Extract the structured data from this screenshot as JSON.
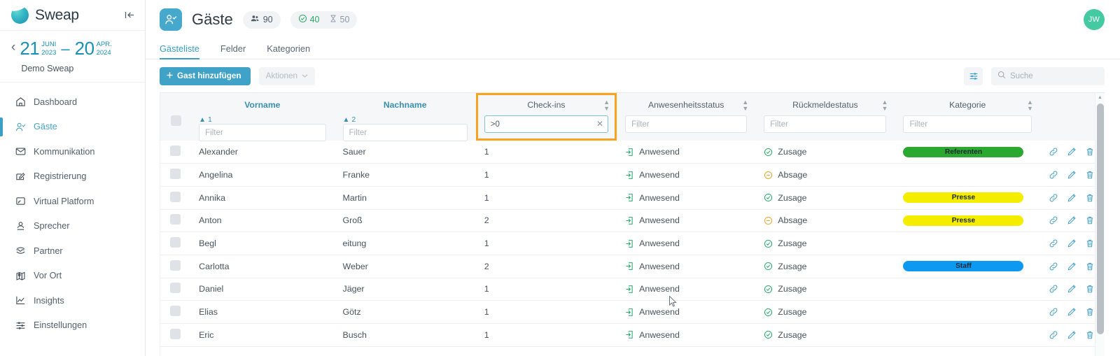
{
  "sidebar": {
    "brand": {
      "name": "Sweap",
      "logo_icon": "sweap-logo",
      "collapse_icon": "collapse-panel-icon"
    },
    "event": {
      "back_icon": "chevron-left-icon",
      "start_day": "21",
      "start_month": "JUNI",
      "start_year": "2023",
      "dash": "–",
      "end_day": "20",
      "end_month": "APR.",
      "end_year": "2024",
      "event_name": "Demo Sweap"
    },
    "items": [
      {
        "label": "Dashboard",
        "icon": "home-icon",
        "active": false
      },
      {
        "label": "Gäste",
        "icon": "user-check-icon",
        "active": true
      },
      {
        "label": "Kommunikation",
        "icon": "envelope-icon",
        "active": false
      },
      {
        "label": "Registrierung",
        "icon": "form-edit-icon",
        "active": false
      },
      {
        "label": "Virtual Platform",
        "icon": "broadcast-icon",
        "active": false
      },
      {
        "label": "Sprecher",
        "icon": "speaker-icon",
        "active": false
      },
      {
        "label": "Partner",
        "icon": "handshake-icon",
        "active": false
      },
      {
        "label": "Vor Ort",
        "icon": "map-pin-icon",
        "active": false
      },
      {
        "label": "Insights",
        "icon": "chart-line-icon",
        "active": false
      },
      {
        "label": "Einstellungen",
        "icon": "sliders-icon",
        "active": false
      }
    ]
  },
  "header": {
    "page_icon": "guests-icon",
    "title": "Gäste",
    "chip_total": {
      "icon": "people-group-icon",
      "value": "90"
    },
    "chip_status": {
      "confirmed_icon": "check-circle-icon",
      "confirmed_value": "40",
      "pending_icon": "hourglass-icon",
      "pending_value": "50"
    },
    "avatar": {
      "initials": "JW",
      "color": "#45c9a0"
    }
  },
  "tabs": [
    {
      "label": "Gästeliste",
      "active": true
    },
    {
      "label": "Felder",
      "active": false
    },
    {
      "label": "Kategorien",
      "active": false
    }
  ],
  "toolbar": {
    "add_guest_label": "Gast hinzufügen",
    "add_icon": "plus-icon",
    "actions_label": "Aktionen",
    "actions_caret": "chevron-down-icon",
    "settings_icon": "table-settings-icon",
    "search": {
      "icon": "search-icon",
      "placeholder": "Suche",
      "value": ""
    }
  },
  "table": {
    "columns": [
      {
        "key": "vorname",
        "label": "Vorname",
        "filter_placeholder": "Filter",
        "filter_value": "",
        "sort": "asc",
        "sort_order": "1",
        "focused": false
      },
      {
        "key": "nachname",
        "label": "Nachname",
        "filter_placeholder": "Filter",
        "filter_value": "",
        "sort": "asc",
        "sort_order": "2",
        "focused": false
      },
      {
        "key": "checkins",
        "label": "Check-ins",
        "filter_placeholder": "Filter",
        "filter_value": ">0",
        "sort": "none",
        "sort_order": "",
        "focused": true
      },
      {
        "key": "anwesend",
        "label": "Anwesenheitsstatus",
        "filter_placeholder": "Filter",
        "filter_value": "",
        "sort": "none",
        "sort_order": "",
        "focused": false
      },
      {
        "key": "rueck",
        "label": "Rückmeldestatus",
        "filter_placeholder": "Filter",
        "filter_value": "",
        "sort": "none",
        "sort_order": "",
        "focused": false
      },
      {
        "key": "kategorie",
        "label": "Kategorie",
        "filter_placeholder": "Filter",
        "filter_value": "",
        "sort": "none",
        "sort_order": "",
        "focused": false
      }
    ],
    "clear_filter_icon": "clear-x-icon",
    "row_actions": [
      {
        "icon": "link-icon"
      },
      {
        "icon": "pencil-icon"
      },
      {
        "icon": "trash-icon"
      }
    ],
    "rows": [
      {
        "vorname": "Alexander",
        "nachname": "Sauer",
        "checkins": "1",
        "anwesend": "Anwesend",
        "rueck": "Zusage",
        "rueck_state": "yes",
        "kategorie": "Referenten",
        "kategorie_color": "#2aa82f"
      },
      {
        "vorname": "Angelina",
        "nachname": "Franke",
        "checkins": "1",
        "anwesend": "Anwesend",
        "rueck": "Absage",
        "rueck_state": "no",
        "kategorie": "",
        "kategorie_color": ""
      },
      {
        "vorname": "Annika",
        "nachname": "Martin",
        "checkins": "1",
        "anwesend": "Anwesend",
        "rueck": "Zusage",
        "rueck_state": "yes",
        "kategorie": "Presse",
        "kategorie_color": "#f5ed00"
      },
      {
        "vorname": "Anton",
        "nachname": "Groß",
        "checkins": "2",
        "anwesend": "Anwesend",
        "rueck": "Absage",
        "rueck_state": "no",
        "kategorie": "Presse",
        "kategorie_color": "#f5ed00"
      },
      {
        "vorname": "Begl",
        "nachname": "eitung",
        "checkins": "1",
        "anwesend": "Anwesend",
        "rueck": "Zusage",
        "rueck_state": "yes",
        "kategorie": "",
        "kategorie_color": ""
      },
      {
        "vorname": "Carlotta",
        "nachname": "Weber",
        "checkins": "2",
        "anwesend": "Anwesend",
        "rueck": "Zusage",
        "rueck_state": "yes",
        "kategorie": "Staff",
        "kategorie_color": "#0d99f2"
      },
      {
        "vorname": "Daniel",
        "nachname": "Jäger",
        "checkins": "1",
        "anwesend": "Anwesend",
        "rueck": "Zusage",
        "rueck_state": "yes",
        "kategorie": "",
        "kategorie_color": ""
      },
      {
        "vorname": "Elias",
        "nachname": "Götz",
        "checkins": "1",
        "anwesend": "Anwesend",
        "rueck": "Zusage",
        "rueck_state": "yes",
        "kategorie": "",
        "kategorie_color": ""
      },
      {
        "vorname": "Eric",
        "nachname": "Busch",
        "checkins": "1",
        "anwesend": "Anwesend",
        "rueck": "Zusage",
        "rueck_state": "yes",
        "kategorie": "",
        "kategorie_color": ""
      }
    ],
    "present_icon": "login-arrow-icon",
    "yes_icon": "check-circle-icon",
    "no_icon": "minus-circle-icon"
  },
  "colors": {
    "accent": "#3fa2c6",
    "focus_outline": "#f9a21b",
    "present_green": "#2aa96a",
    "decline_amber": "#e0a735"
  }
}
